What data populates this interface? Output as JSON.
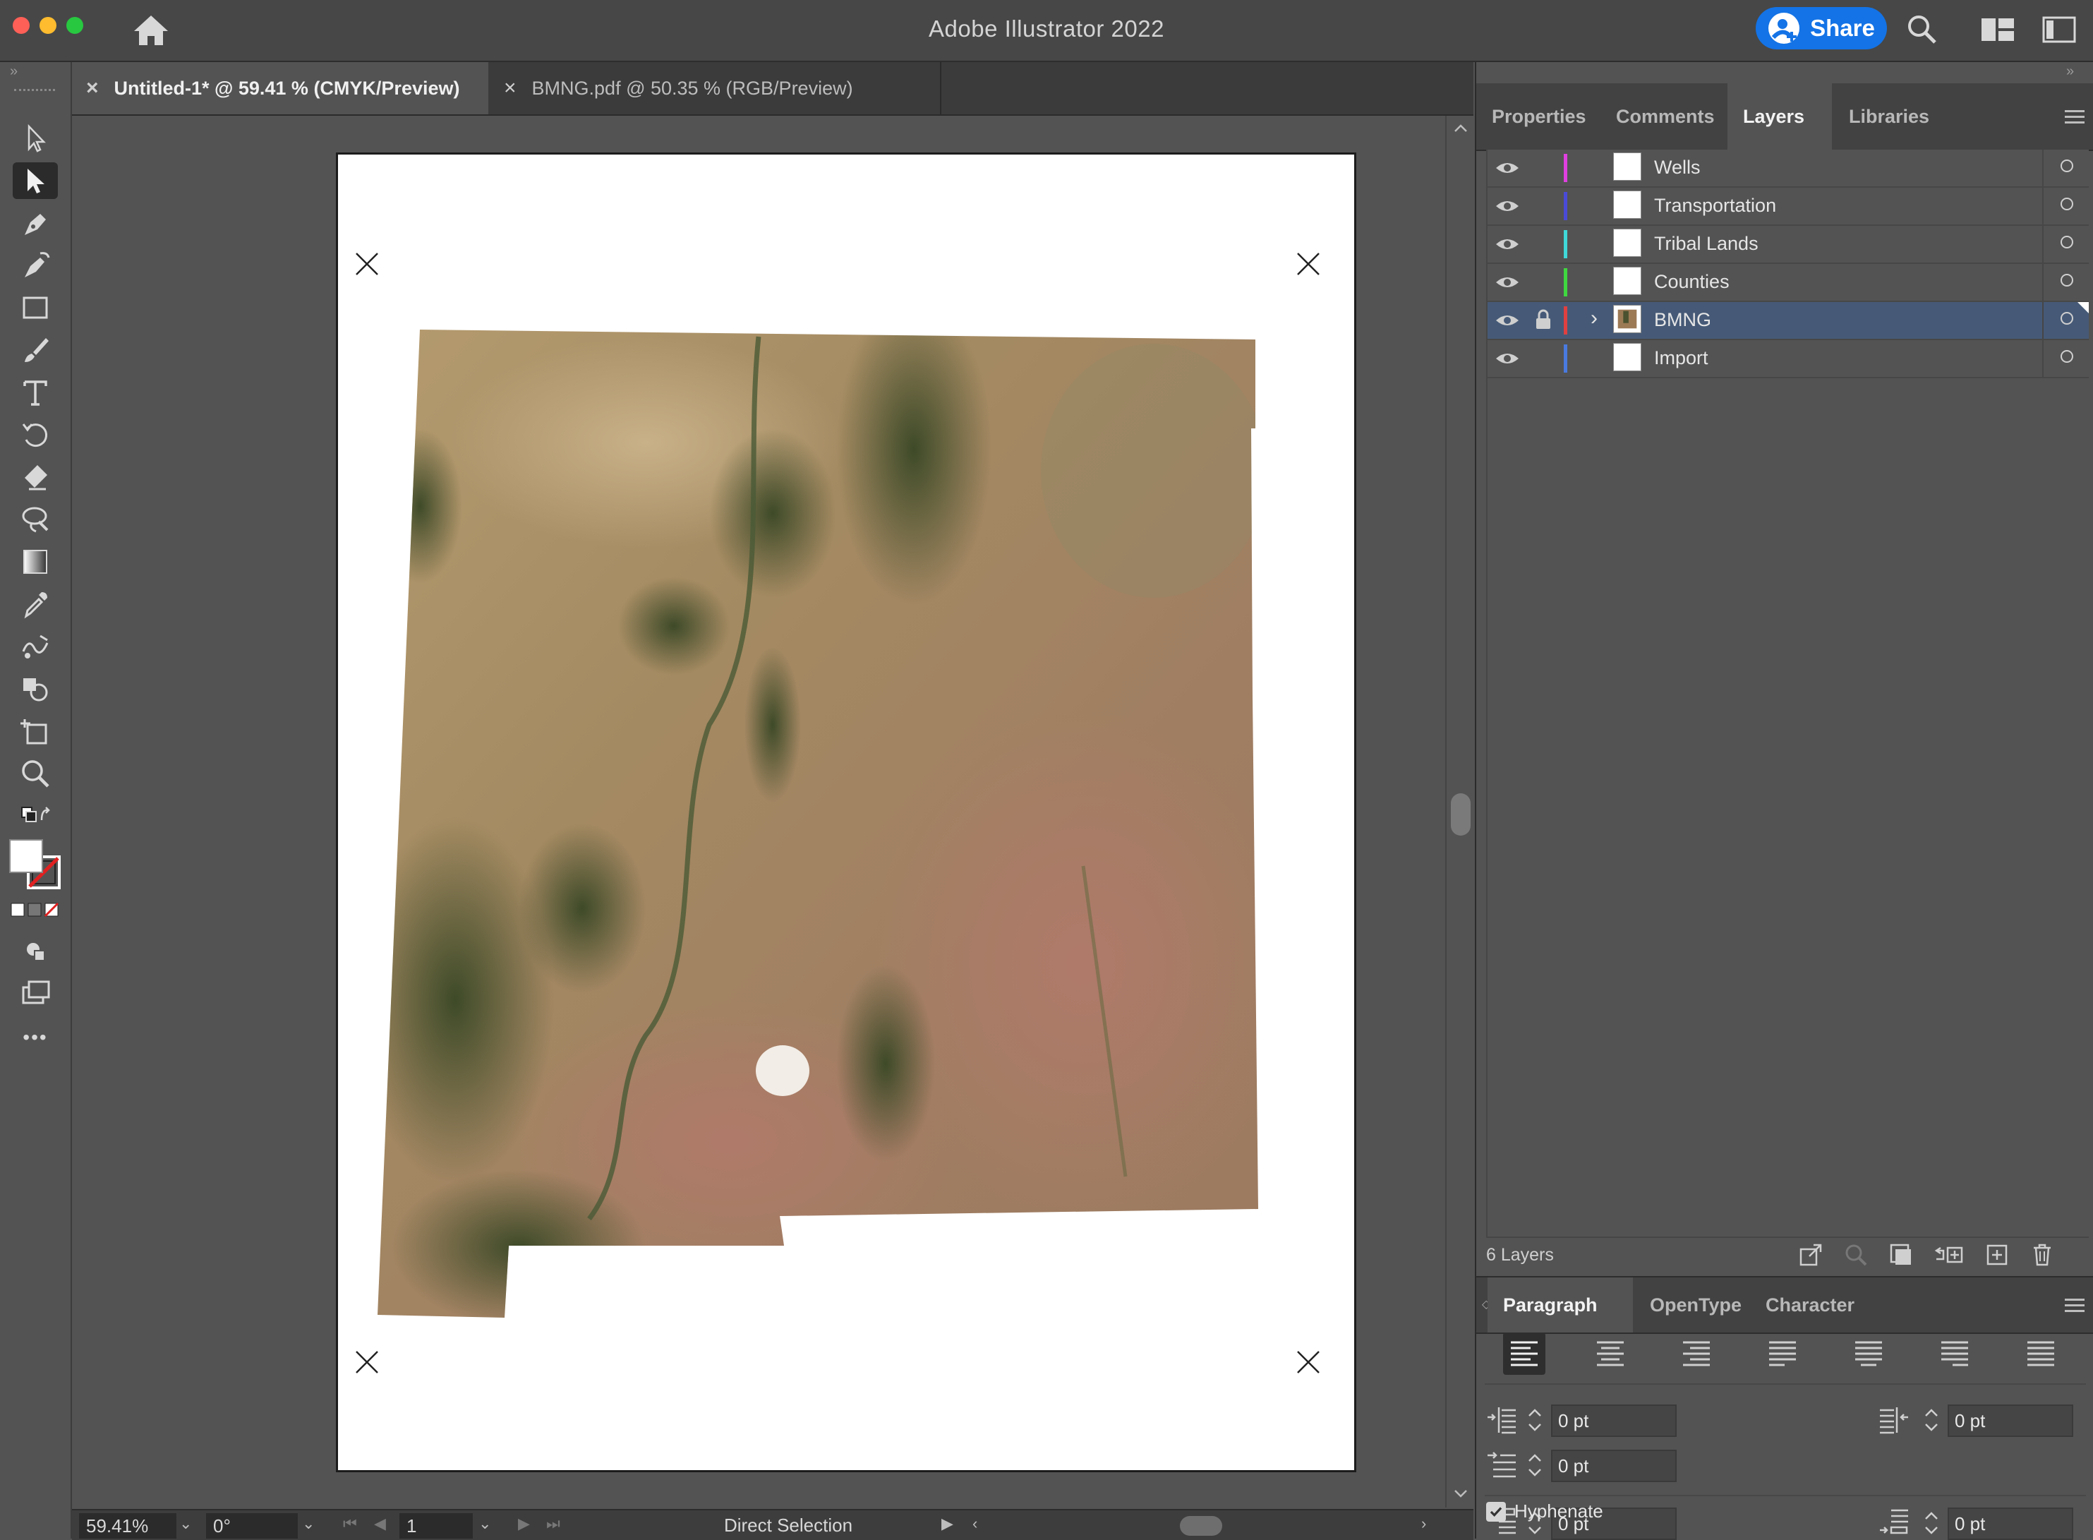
{
  "window": {
    "title": "Adobe Illustrator 2022"
  },
  "header": {
    "share_label": "Share"
  },
  "document_tabs": [
    {
      "label": "Untitled-1* @ 59.41 % (CMYK/Preview)",
      "active": true
    },
    {
      "label": "BMNG.pdf @ 50.35 % (RGB/Preview)",
      "active": false
    }
  ],
  "toolbar": {
    "collapse_glyph": "»",
    "tools": [
      "selection-tool",
      "direct-selection-tool",
      "pen-tool",
      "curvature-tool",
      "rectangle-tool",
      "paintbrush-tool",
      "type-tool",
      "rotate-tool",
      "eraser-tool",
      "lasso-tool",
      "gradient-tool",
      "eyedropper-tool",
      "blend-tool",
      "shape-builder-tool",
      "artboard-tool",
      "zoom-tool"
    ],
    "more_glyph": "•••"
  },
  "panels": {
    "collapse_glyph": "»",
    "tabs": [
      {
        "label": "Properties",
        "active": false
      },
      {
        "label": "Comments",
        "active": false
      },
      {
        "label": "Layers",
        "active": true
      },
      {
        "label": "Libraries",
        "active": false
      }
    ]
  },
  "layers": {
    "items": [
      {
        "name": "Wells",
        "color": "#e040e0",
        "locked": false,
        "selected": false,
        "expandable": false
      },
      {
        "name": "Transportation",
        "color": "#4a4ad8",
        "locked": false,
        "selected": false,
        "expandable": false
      },
      {
        "name": "Tribal Lands",
        "color": "#40d8d8",
        "locked": false,
        "selected": false,
        "expandable": false
      },
      {
        "name": "Counties",
        "color": "#40d840",
        "locked": false,
        "selected": false,
        "expandable": false
      },
      {
        "name": "BMNG",
        "color": "#e04040",
        "locked": true,
        "selected": true,
        "expandable": true
      },
      {
        "name": "Import",
        "color": "#4a7ae0",
        "locked": false,
        "selected": false,
        "expandable": false
      }
    ],
    "count_label": "6 Layers"
  },
  "paragraph_panel": {
    "tabs": [
      {
        "label": "Paragraph",
        "active": true
      },
      {
        "label": "OpenType",
        "active": false
      },
      {
        "label": "Character",
        "active": false
      }
    ],
    "left_indent": "0 pt",
    "right_indent": "0 pt",
    "first_line_indent": "0 pt",
    "space_before": "0 pt",
    "space_after": "0 pt",
    "hyphenate_label": "Hyphenate",
    "hyphenate_checked": true
  },
  "statusbar": {
    "zoom": "59.41%",
    "rotation": "0°",
    "artboard": "1",
    "current_tool": "Direct Selection"
  }
}
